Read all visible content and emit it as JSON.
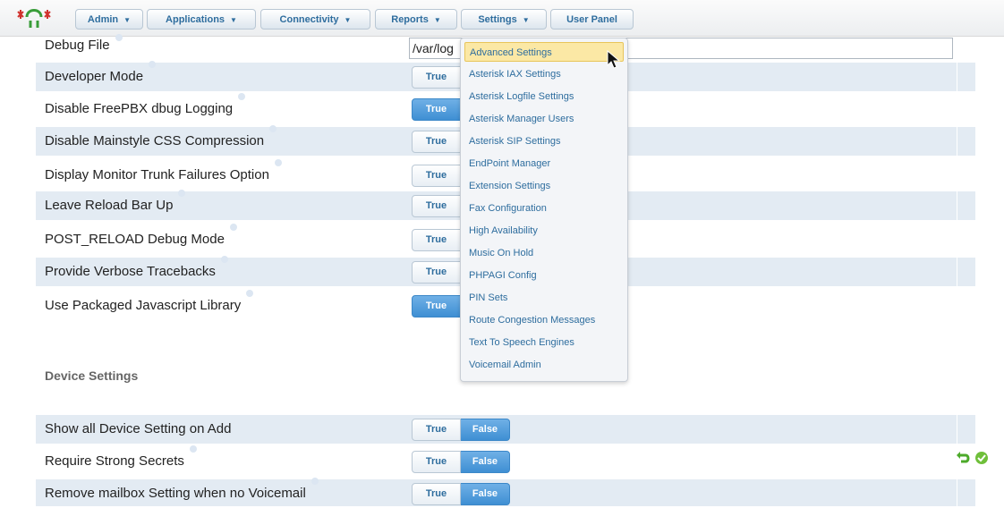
{
  "nav": {
    "items": [
      {
        "label": "Admin",
        "has_caret": true
      },
      {
        "label": "Applications",
        "has_caret": true
      },
      {
        "label": "Connectivity",
        "has_caret": true
      },
      {
        "label": "Reports",
        "has_caret": true
      },
      {
        "label": "Settings",
        "has_caret": true
      },
      {
        "label": "User Panel",
        "has_caret": false
      }
    ],
    "caret_glyph": "▼",
    "logo_icon": "freepbx-logo-icon"
  },
  "settings": {
    "debug_file": {
      "label": "Debug File",
      "value": "/var/log"
    },
    "rows": [
      {
        "label": "Developer Mode",
        "true_label": "True",
        "value": "true"
      },
      {
        "label": "Disable FreePBX dbug Logging",
        "true_label": "True",
        "value": "true"
      },
      {
        "label": "Disable Mainstyle CSS Compression",
        "true_label": "True",
        "value": "false"
      },
      {
        "label": "Display Monitor Trunk Failures Option",
        "true_label": "True",
        "value": "false"
      },
      {
        "label": "Leave Reload Bar Up",
        "true_label": "True",
        "value": "false"
      },
      {
        "label": "POST_RELOAD Debug Mode",
        "true_label": "True",
        "value": "false"
      },
      {
        "label": "Provide Verbose Tracebacks",
        "true_label": "True",
        "value": "false"
      },
      {
        "label": "Use Packaged Javascript Library",
        "true_label": "True",
        "value": "true"
      }
    ]
  },
  "device_settings": {
    "title": "Device Settings",
    "rows": [
      {
        "label": "Show all Device Setting on Add",
        "true_label": "True",
        "false_label": "False",
        "value": "false"
      },
      {
        "label": "Require Strong Secrets",
        "true_label": "True",
        "false_label": "False",
        "value": "false"
      },
      {
        "label": "Remove mailbox Setting when no Voicemail",
        "true_label": "True",
        "false_label": "False",
        "value": "false"
      }
    ]
  },
  "row_actions": {
    "icons": [
      "undo-icon",
      "check-icon"
    ],
    "colors": {
      "undo": "#4caa2a",
      "check": "#6fbf3a"
    }
  },
  "settings_menu": {
    "items": [
      "Advanced Settings",
      "Asterisk IAX Settings",
      "Asterisk Logfile Settings",
      "Asterisk Manager Users",
      "Asterisk SIP Settings",
      "EndPoint Manager",
      "Extension Settings",
      "Fax Configuration",
      "High Availability",
      "Music On Hold",
      "PHPAGI Config",
      "PIN Sets",
      "Route Congestion Messages",
      "Text To Speech Engines",
      "Voicemail Admin"
    ],
    "highlighted": "Advanced Settings"
  },
  "colors": {
    "accent": "#2e6d9e",
    "row_shade": "#e3ebf3",
    "active_toggle": "#3f8fd3",
    "menu_hover": "#fbe8a5"
  }
}
